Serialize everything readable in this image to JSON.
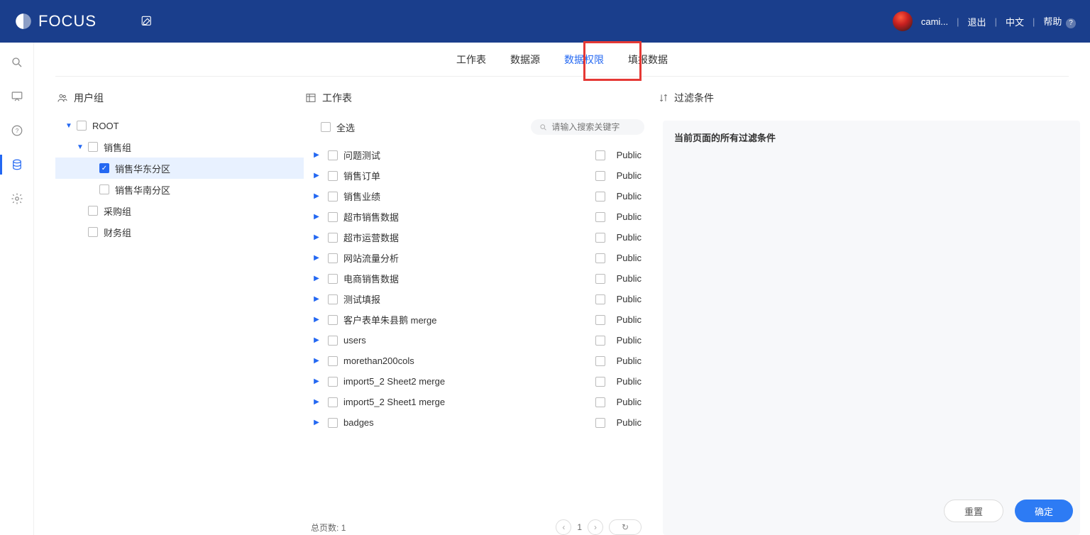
{
  "header": {
    "brand": "FOCUS",
    "username": "cami...",
    "logout": "退出",
    "lang": "中文",
    "help": "帮助"
  },
  "tabs": {
    "items": [
      "工作表",
      "数据源",
      "数据权限",
      "填报数据"
    ],
    "active_index": 2
  },
  "groups": {
    "title": "用户组",
    "tree": {
      "root": "ROOT",
      "sales": "销售组",
      "sales_east": "销售华东分区",
      "sales_south": "销售华南分区",
      "purchase": "采购组",
      "finance": "财务组"
    }
  },
  "tables": {
    "title": "工作表",
    "select_all": "全选",
    "search_placeholder": "请输入搜索关键字",
    "rows": [
      {
        "name": "问题测试",
        "tag": "Public"
      },
      {
        "name": "销售订单",
        "tag": "Public"
      },
      {
        "name": "销售业绩",
        "tag": "Public"
      },
      {
        "name": "超市销售数据",
        "tag": "Public"
      },
      {
        "name": "超市运营数据",
        "tag": "Public"
      },
      {
        "name": "网站流量分析",
        "tag": "Public"
      },
      {
        "name": "电商销售数据",
        "tag": "Public"
      },
      {
        "name": "测试填报",
        "tag": "Public"
      },
      {
        "name": "客户表单朱县鹅 merge",
        "tag": "Public"
      },
      {
        "name": "users",
        "tag": "Public"
      },
      {
        "name": "morethan200cols",
        "tag": "Public"
      },
      {
        "name": "import5_2 Sheet2 merge",
        "tag": "Public"
      },
      {
        "name": "import5_2 Sheet1 merge",
        "tag": "Public"
      },
      {
        "name": "badges",
        "tag": "Public"
      }
    ],
    "pager": {
      "total_label": "总页数:",
      "total": "1",
      "current": "1"
    }
  },
  "filter": {
    "title": "过滤条件",
    "body": "当前页面的所有过滤条件"
  },
  "footer": {
    "reset": "重置",
    "confirm": "确定"
  }
}
